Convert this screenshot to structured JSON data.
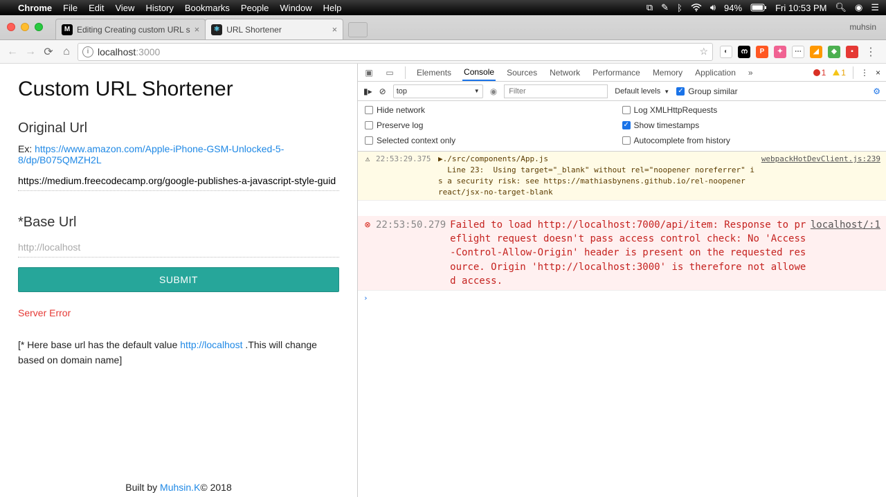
{
  "menubar": {
    "app": "Chrome",
    "items": [
      "File",
      "Edit",
      "View",
      "History",
      "Bookmarks",
      "People",
      "Window",
      "Help"
    ],
    "battery": "94%",
    "clock": "Fri 10:53 PM"
  },
  "chrome": {
    "profile": "muhsin",
    "tabs": [
      {
        "title": "Editing Creating custom URL s",
        "favicon": "M",
        "favbg": "#000",
        "active": false
      },
      {
        "title": "URL Shortener",
        "favicon": "⚛",
        "favbg": "#222",
        "active": true
      }
    ],
    "url_prefix": "localhost",
    "url_suffix": ":3000"
  },
  "page": {
    "h1": "Custom URL Shortener",
    "orig_label": "Original Url",
    "ex_prefix": "Ex: ",
    "ex_link": "https://www.amazon.com/Apple-iPhone-GSM-Unlocked-5-8/dp/B075QMZH2L",
    "orig_value": "https://medium.freecodecamp.org/google-publishes-a-javascript-style-guid",
    "base_label": "*Base Url",
    "base_placeholder": "http://localhost",
    "submit": "SUBMIT",
    "error": "Server Error",
    "note_pre": "[* Here base url has the default value ",
    "note_link": "http://localhost",
    "note_post": " .This will change based on domain name]",
    "footer_pre": "Built by ",
    "footer_link": "Muhsin.K",
    "footer_post": "© 2018"
  },
  "devtools": {
    "tabs": [
      "Elements",
      "Console",
      "Sources",
      "Network",
      "Performance",
      "Memory",
      "Application"
    ],
    "active_tab": "Console",
    "err_count": "1",
    "warn_count": "1",
    "context": "top",
    "filter_placeholder": "Filter",
    "levels": "Default levels",
    "group_similar": "Group similar",
    "options_left": [
      "Hide network",
      "Preserve log",
      "Selected context only"
    ],
    "options_right": [
      {
        "label": "Log XMLHttpRequests",
        "checked": false
      },
      {
        "label": "Show timestamps",
        "checked": true
      },
      {
        "label": "Autocomplete from history",
        "checked": false
      }
    ],
    "logs": [
      {
        "type": "warn",
        "ts": "22:53:29.375",
        "arrow": "▶",
        "file": "./src/components/App.js",
        "body": "  Line 23:  Using target=\"_blank\" without rel=\"noopener noreferrer\" is a security risk: see https://mathiasbynens.github.io/rel-noopener  react/jsx-no-target-blank",
        "src": "webpackHotDevClient.js:239"
      },
      {
        "type": "err",
        "ts": "22:53:50.279",
        "body": "Failed to load http://localhost:7000/api/item: Response to preflight request doesn't pass access control check: No 'Access-Control-Allow-Origin' header is present on the requested resource. Origin 'http://localhost:3000' is therefore not allowed access.",
        "src": "localhost/:1"
      }
    ]
  }
}
